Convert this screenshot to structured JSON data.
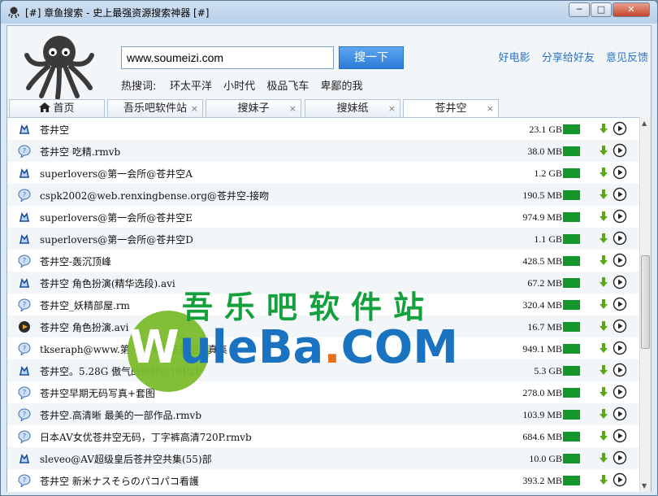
{
  "window": {
    "title": "[#] 章鱼搜索 - 史上最强资源搜索神器 [#]",
    "min_label": "─",
    "max_label": "□",
    "close_label": "✕"
  },
  "search": {
    "value": "www.soumeizi.com",
    "button_label": "搜一下"
  },
  "hot": {
    "label": "热搜词:",
    "items": [
      "环太平洋",
      "小时代",
      "极品飞车",
      "卑鄙的我"
    ]
  },
  "top_links": [
    "好电影",
    "分享给好友",
    "意见反馈"
  ],
  "tabs": [
    {
      "label": "首页",
      "closable": false
    },
    {
      "label": "吾乐吧软件站",
      "closable": true
    },
    {
      "label": "搜妹子",
      "closable": true
    },
    {
      "label": "搜妹纸",
      "closable": true
    },
    {
      "label": "苍井空",
      "closable": true
    }
  ],
  "tab_close_glyph": "×",
  "rows": [
    {
      "icon": "hexagon-icon",
      "name": "苍井空",
      "size": "23.1 GB"
    },
    {
      "icon": "chat-bubble-icon",
      "name": "苍井空  吃精.rmvb",
      "size": "38.0 MB"
    },
    {
      "icon": "hexagon-icon",
      "name": "superlovers@第一会所@苍井空A",
      "size": "1.2 GB"
    },
    {
      "icon": "chat-bubble-icon",
      "name": "cspk2002@web.renxingbense.org@苍井空-接吻",
      "size": "190.5 MB"
    },
    {
      "icon": "hexagon-icon",
      "name": "superlovers@第一会所@苍井空E",
      "size": "974.9 MB"
    },
    {
      "icon": "hexagon-icon",
      "name": "superlovers@第一会所@苍井空D",
      "size": "1.1 GB"
    },
    {
      "icon": "chat-bubble-icon",
      "name": "苍井空-轰沉顶峰",
      "size": "428.5 MB"
    },
    {
      "icon": "hexagon-icon",
      "name": "苍井空  角色扮演(精华选段).avi",
      "size": "67.2 MB"
    },
    {
      "icon": "chat-bubble-icon",
      "name": "苍井空_妖精部屋.rm",
      "size": "320.4 MB"
    },
    {
      "icon": "media-player-icon",
      "name": "苍井空  角色扮演.avi",
      "size": "16.7 MB"
    },
    {
      "icon": "chat-bubble-icon",
      "name": "tkseraph@www.第一会所@苍井空写真集",
      "size": "949.1 MB"
    },
    {
      "icon": "hexagon-icon",
      "name": "苍井空。5.28G 傲气的钟钟@18P2P",
      "size": "5.3 GB"
    },
    {
      "icon": "chat-bubble-icon",
      "name": "苍井空早期无码写真+套图",
      "size": "278.0 MB"
    },
    {
      "icon": "chat-bubble-icon",
      "name": "苍井空.高清晰  最美的一部作品.rmvb",
      "size": "103.9 MB"
    },
    {
      "icon": "chat-bubble-icon",
      "name": "日本AV女优苍井空无码，丁字裤高清720P.rmvb",
      "size": "684.6 MB"
    },
    {
      "icon": "hexagon-icon",
      "name": "sleveo@AV超级皇后苍井空共集(55)部",
      "size": "10.0 GB"
    },
    {
      "icon": "chat-bubble-icon",
      "name": "苍井空  新米ナスそらのパコパコ看護",
      "size": "393.2 MB"
    }
  ],
  "watermark": {
    "cn": "吾乐吧软件站",
    "w": "W",
    "ule": "uleBa",
    "dot": ".",
    "com": "COM"
  },
  "colors": {
    "accent": "#2c7bd8",
    "link": "#2a72c5",
    "bar": "#14962a",
    "download": "#5aa818"
  }
}
